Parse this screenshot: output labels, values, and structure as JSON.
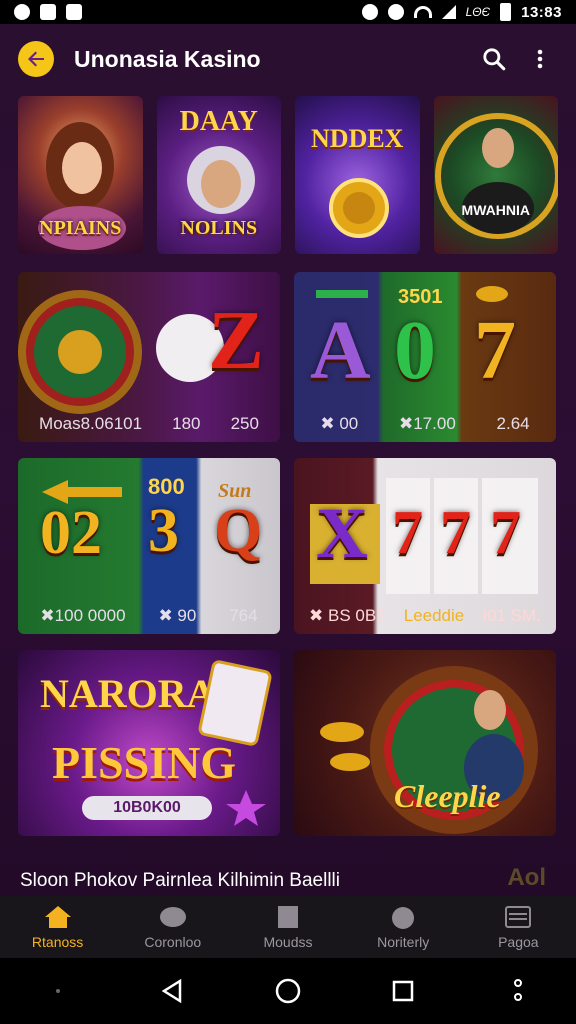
{
  "status_bar": {
    "time": "13:83",
    "indicator_text": "LΘЄ"
  },
  "app_bar": {
    "title": "Unonasia Kasino",
    "icons": [
      "back-arrow-icon",
      "search-icon",
      "more-vert-icon"
    ]
  },
  "featured_tiles": [
    {
      "top": "",
      "label": "NPIAINS"
    },
    {
      "top": "DAAY",
      "label": "NOLINS"
    },
    {
      "top": "NDDEX",
      "label": ""
    },
    {
      "top": "",
      "label": "MWAHNIA"
    }
  ],
  "games": [
    {
      "captions": [
        "Moas8.06101",
        "180",
        "250"
      ],
      "symbols": [
        "Z"
      ]
    },
    {
      "captions": [
        "✖ 00",
        "✖17.00",
        "2.64"
      ],
      "header": "3501",
      "symbols": [
        "A",
        "0",
        "7"
      ]
    },
    {
      "captions": [
        "✖100 0000",
        "✖ 90",
        "764"
      ],
      "header_left": "800",
      "header_right": "Sun",
      "symbols": [
        "02",
        "3",
        "Q"
      ]
    },
    {
      "captions": [
        "✖ BS 0B7",
        "Leeddie",
        "I01 SM."
      ],
      "symbols": [
        "X",
        "7",
        "7",
        "7"
      ]
    },
    {
      "title": "NARORA",
      "subtitle": "PISSING",
      "badge": "10B0K00"
    },
    {
      "title": "Cleeplie"
    }
  ],
  "section": {
    "title": "Sloon Phokov Pairnlea Kilhimin Baellli",
    "side_text": "Aol"
  },
  "bottom_nav": [
    {
      "label": "Rtanoss",
      "icon": "home-icon",
      "active": true
    },
    {
      "label": "Coronloo",
      "icon": "cards-icon",
      "active": false
    },
    {
      "label": "Moudss",
      "icon": "grid-icon",
      "active": false
    },
    {
      "label": "Noriterly",
      "icon": "bag-icon",
      "active": false
    },
    {
      "label": "Pagoa",
      "icon": "list-icon",
      "active": false
    }
  ],
  "colors": {
    "accent": "#f5b220",
    "background": "#2a0f30",
    "nav_background": "#18151b"
  }
}
